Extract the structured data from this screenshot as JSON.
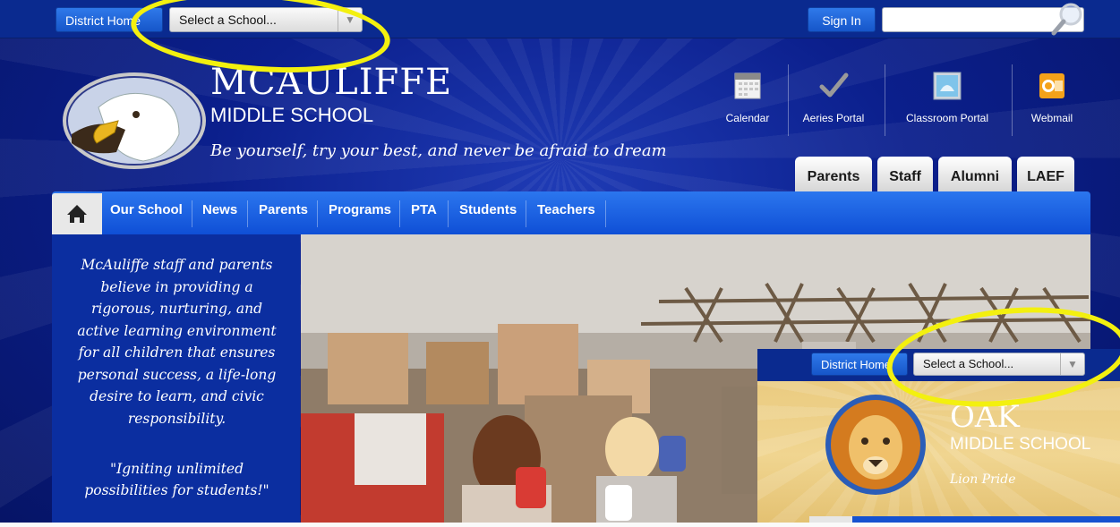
{
  "topbar": {
    "district_home_label": "District Home",
    "school_select_value": "Select a School...",
    "sign_in_label": "Sign In",
    "search_value": ""
  },
  "header": {
    "title_line1": "MCAULIFFE",
    "title_line2": "MIDDLE SCHOOL",
    "tagline": "Be yourself, try your best, and never be afraid to dream"
  },
  "quick_links": [
    {
      "label": "Calendar",
      "icon": "calendar-icon"
    },
    {
      "label": "Aeries Portal",
      "icon": "checkmark-icon"
    },
    {
      "label": "Classroom Portal",
      "icon": "classroom-portal-icon"
    },
    {
      "label": "Webmail",
      "icon": "outlook-icon"
    }
  ],
  "audience_tabs": [
    "Parents",
    "Staff",
    "Alumni",
    "LAEF"
  ],
  "nav": {
    "home_icon": "home-icon",
    "items": [
      "Our School",
      "News",
      "Parents",
      "Programs",
      "PTA",
      "Students",
      "Teachers"
    ]
  },
  "sidebar": {
    "mission": "McAuliffe staff and parents believe in providing a rigorous, nurturing, and active learning environment for all children that ensures personal success, a life-long desire to learn, and civic responsibility.",
    "quote": "\"Igniting unlimited possibilities for students!\""
  },
  "inset": {
    "district_home_label": "District Home",
    "school_select_value": "Select a School...",
    "title_line1": "OAK",
    "title_line2": "MIDDLE SCHOOL",
    "tagline": "Lion Pride"
  },
  "colors": {
    "page_bg": "#0b1f8c",
    "nav_blue": "#1656c9",
    "highlight": "#f3f00f",
    "oak_bg": "#f0d590"
  }
}
